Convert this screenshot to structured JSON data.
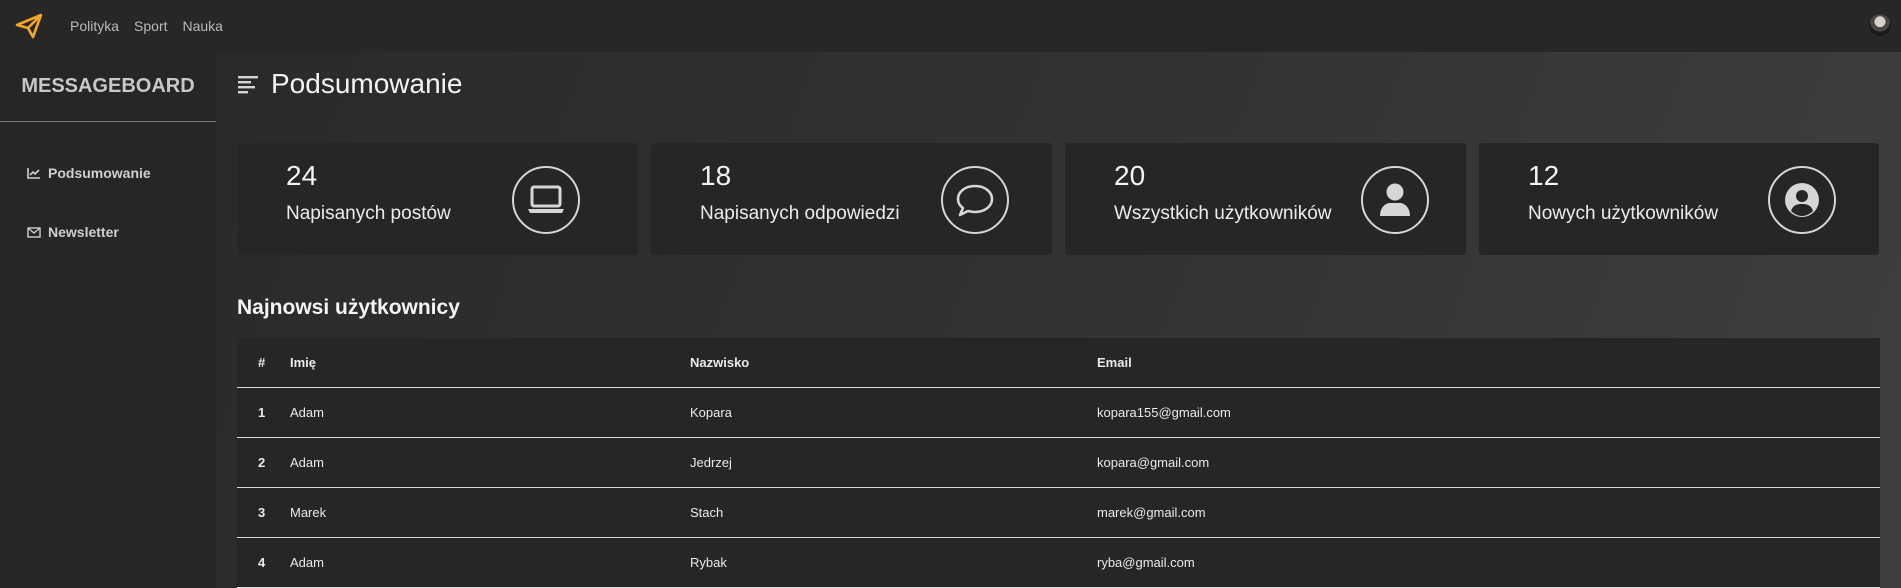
{
  "topbar": {
    "logo_icon": "paper-plane-icon",
    "nav": [
      "Polityka",
      "Sport",
      "Nauka"
    ]
  },
  "sidebar": {
    "brand": "MESSAGEBOARD",
    "items": [
      {
        "label": "Podsumowanie",
        "icon": "chart-line-icon"
      },
      {
        "label": "Newsletter",
        "icon": "envelope-icon"
      }
    ]
  },
  "main": {
    "title": "Podsumowanie",
    "cards": [
      {
        "value": "24",
        "label": "Napisanych postów",
        "icon": "laptop-icon"
      },
      {
        "value": "18",
        "label": "Napisanych odpowiedzi",
        "icon": "comment-icon"
      },
      {
        "value": "20",
        "label": "Wszystkich użytkowników",
        "icon": "user-icon"
      },
      {
        "value": "12",
        "label": "Nowych użytkowników",
        "icon": "user-circle-icon"
      }
    ],
    "section_title": "Najnowsi użytkownicy",
    "table": {
      "headers": [
        "#",
        "Imię",
        "Nazwisko",
        "Email"
      ],
      "rows": [
        [
          "1",
          "Adam",
          "Kopara",
          "kopara155@gmail.com"
        ],
        [
          "2",
          "Adam",
          "Jedrzej",
          "kopara@gmail.com"
        ],
        [
          "3",
          "Marek",
          "Stach",
          "marek@gmail.com"
        ],
        [
          "4",
          "Adam",
          "Rybak",
          "ryba@gmail.com"
        ]
      ]
    }
  },
  "colors": {
    "accent": "#f5a623",
    "background": "#2b2b2b",
    "panel": "#262626"
  }
}
